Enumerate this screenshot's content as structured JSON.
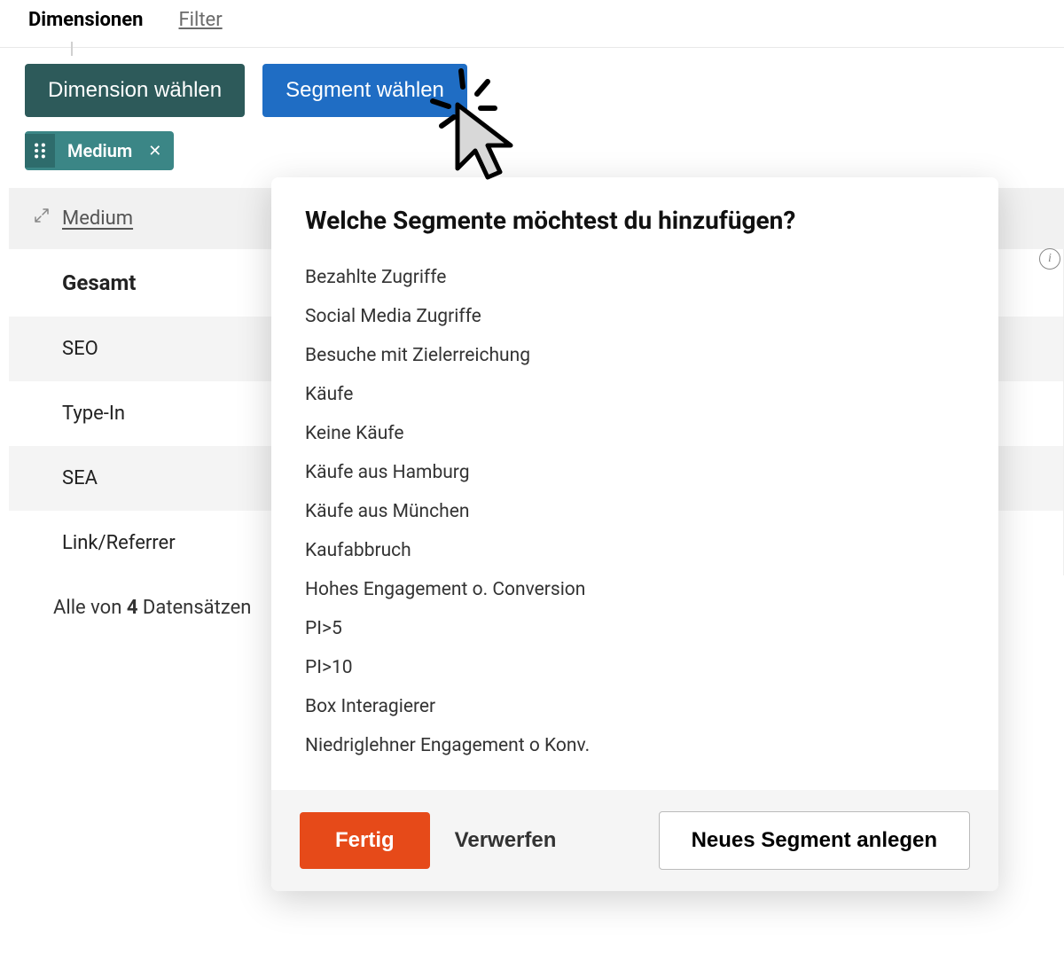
{
  "tabs": {
    "dimensionen": "Dimensionen",
    "filter": "Filter"
  },
  "toolbar": {
    "dimension_btn": "Dimension wählen",
    "segment_btn": "Segment wählen"
  },
  "chip": {
    "label": "Medium"
  },
  "table": {
    "col_header": "Medium",
    "total_label": "Gesamt",
    "rows": [
      "SEO",
      "Type-In",
      "SEA",
      "Link/Referrer"
    ]
  },
  "records": {
    "prefix": "Alle von ",
    "count": "4",
    "suffix": " Datensätzen"
  },
  "popover": {
    "title": "Welche Segmente möchtest du hinzufügen?",
    "items": [
      "Bezahlte Zugriffe",
      "Social Media Zugriffe",
      "Besuche mit Zielerreichung",
      "Käufe",
      "Keine Käufe",
      "Käufe aus Hamburg",
      "Käufe aus München",
      "Kaufabbruch",
      "Hohes Engagement o. Conversion",
      "PI>5",
      "PI>10",
      "Box Interagierer",
      "Niedriglehner Engagement o Konv."
    ],
    "done": "Fertig",
    "discard": "Verwerfen",
    "new_segment": "Neues Segment anlegen"
  }
}
